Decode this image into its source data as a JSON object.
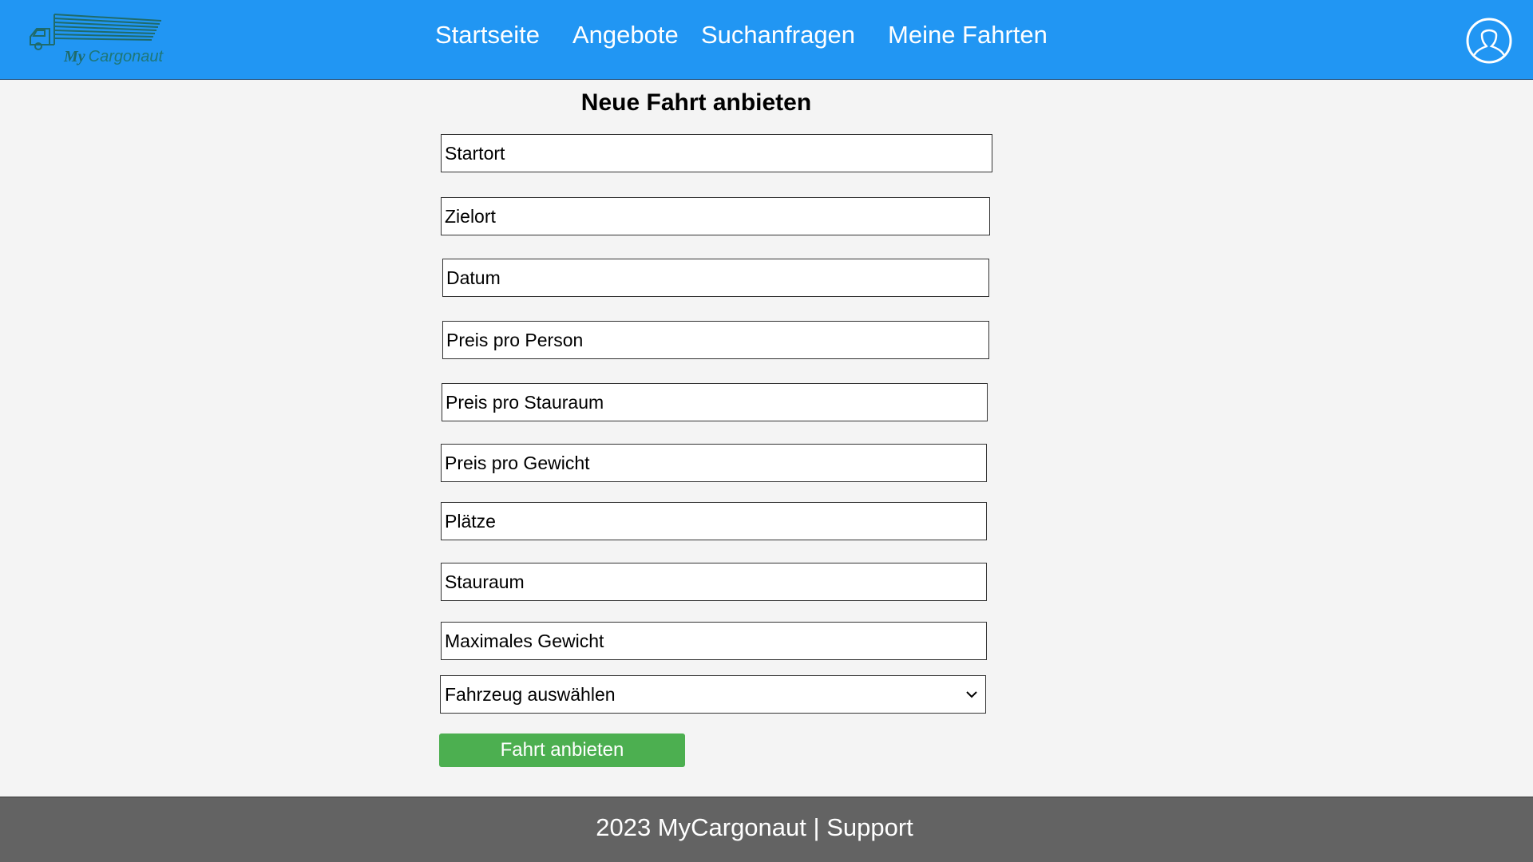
{
  "header": {
    "logo": {
      "prefix": "My",
      "brand": "Cargonaut"
    },
    "nav": [
      {
        "label": "Startseite"
      },
      {
        "label": "Angebote"
      },
      {
        "label": "Suchanfragen"
      },
      {
        "label": "Meine Fahrten"
      }
    ],
    "profile_icon": "user-profile-icon"
  },
  "form": {
    "title": "Neue Fahrt anbieten",
    "fields": [
      {
        "placeholder": "Startort",
        "value": ""
      },
      {
        "placeholder": "Zielort",
        "value": ""
      },
      {
        "placeholder": "Datum",
        "value": ""
      },
      {
        "placeholder": "Preis pro Person",
        "value": ""
      },
      {
        "placeholder": "Preis pro Stauraum",
        "value": ""
      },
      {
        "placeholder": "Preis pro Gewicht",
        "value": ""
      },
      {
        "placeholder": "Plätze",
        "value": ""
      },
      {
        "placeholder": "Stauraum",
        "value": ""
      },
      {
        "placeholder": "Maximales Gewicht",
        "value": ""
      }
    ],
    "vehicle_select": {
      "selected": "Fahrzeug auswählen",
      "icon": "chevron-down-icon"
    },
    "submit_label": "Fahrt anbieten"
  },
  "footer": {
    "text": "2023 MyCargonaut",
    "separator": "|",
    "link": "Support"
  },
  "colors": {
    "navbar": "#2196f3",
    "background": "#f4f4f4",
    "submit": "#4caf50",
    "footer": "#636363",
    "logo": "#1f6b6b"
  }
}
